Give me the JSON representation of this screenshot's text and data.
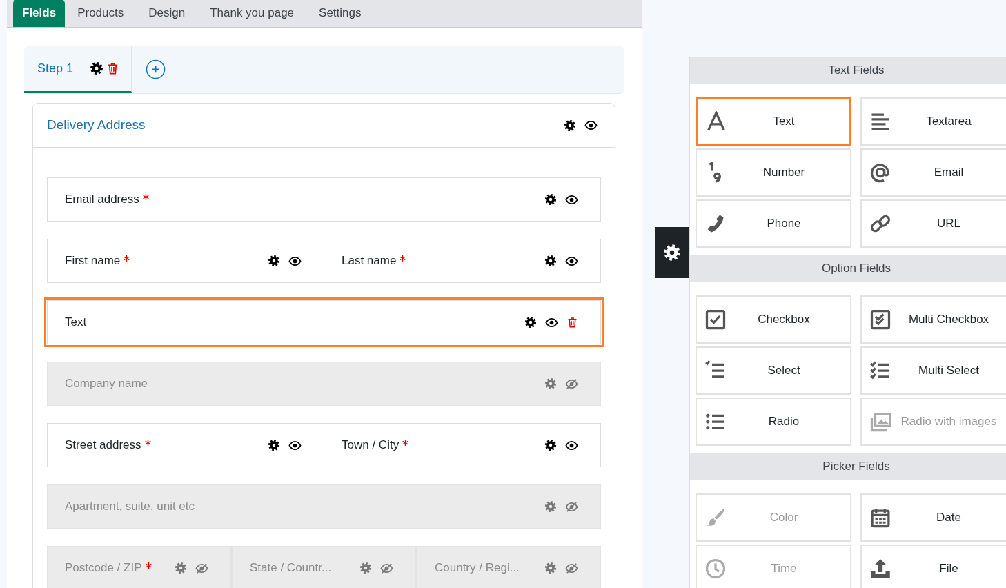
{
  "tabs": [
    {
      "label": "Fields",
      "selected": true
    },
    {
      "label": "Products",
      "selected": false
    },
    {
      "label": "Design",
      "selected": false
    },
    {
      "label": "Thank you page",
      "selected": false
    },
    {
      "label": "Settings",
      "selected": false
    }
  ],
  "steps": [
    {
      "label": "Step 1",
      "selected": true
    }
  ],
  "section": {
    "title": "Delivery Address",
    "hidden": false
  },
  "field_rows": [
    [
      {
        "label": "Email address",
        "required": true,
        "hidden": false,
        "selected": false
      }
    ],
    [
      {
        "label": "First name",
        "required": true,
        "hidden": false,
        "selected": false
      },
      {
        "label": "Last name",
        "required": true,
        "hidden": false,
        "selected": false
      }
    ],
    [
      {
        "label": "Text",
        "required": false,
        "hidden": false,
        "selected": true
      }
    ],
    [
      {
        "label": "Company name",
        "required": false,
        "hidden": true,
        "selected": false
      }
    ],
    [
      {
        "label": "Street address",
        "required": true,
        "hidden": false,
        "selected": false
      },
      {
        "label": "Town / City",
        "required": true,
        "hidden": false,
        "selected": false
      }
    ],
    [
      {
        "label": "Apartment, suite, unit etc",
        "required": false,
        "hidden": true,
        "selected": false
      }
    ],
    [
      {
        "label": "Postcode / ZIP",
        "required": true,
        "hidden": true,
        "selected": false
      },
      {
        "label": "State / Countr...",
        "required": false,
        "hidden": true,
        "selected": false
      },
      {
        "label": "Country / Regi...",
        "required": false,
        "hidden": true,
        "selected": false
      }
    ]
  ],
  "palette": {
    "groups": [
      {
        "title": "Text Fields",
        "items": [
          {
            "label": "Text",
            "kind": "text",
            "disabled": false,
            "selected": true
          },
          {
            "label": "Textarea",
            "kind": "textarea",
            "disabled": false,
            "selected": false
          },
          {
            "label": "Number",
            "kind": "number",
            "disabled": false,
            "selected": false
          },
          {
            "label": "Email",
            "kind": "email",
            "disabled": false,
            "selected": false
          },
          {
            "label": "Phone",
            "kind": "phone",
            "disabled": false,
            "selected": false
          },
          {
            "label": "URL",
            "kind": "url",
            "disabled": false,
            "selected": false
          }
        ]
      },
      {
        "title": "Option Fields",
        "items": [
          {
            "label": "Checkbox",
            "kind": "checkbox",
            "disabled": false,
            "selected": false
          },
          {
            "label": "Multi Checkbox",
            "kind": "multicheckbox",
            "disabled": false,
            "selected": false
          },
          {
            "label": "Select",
            "kind": "select",
            "disabled": false,
            "selected": false
          },
          {
            "label": "Multi Select",
            "kind": "multiselect",
            "disabled": false,
            "selected": false
          },
          {
            "label": "Radio",
            "kind": "radio",
            "disabled": false,
            "selected": false
          },
          {
            "label": "Radio with images",
            "kind": "images",
            "disabled": true,
            "selected": false
          }
        ]
      },
      {
        "title": "Picker Fields",
        "items": [
          {
            "label": "Color",
            "kind": "color",
            "disabled": true,
            "selected": false
          },
          {
            "label": "Date",
            "kind": "date",
            "disabled": false,
            "selected": false
          },
          {
            "label": "Time",
            "kind": "time",
            "disabled": true,
            "selected": false
          },
          {
            "label": "File",
            "kind": "file",
            "disabled": false,
            "selected": false
          }
        ]
      }
    ]
  }
}
